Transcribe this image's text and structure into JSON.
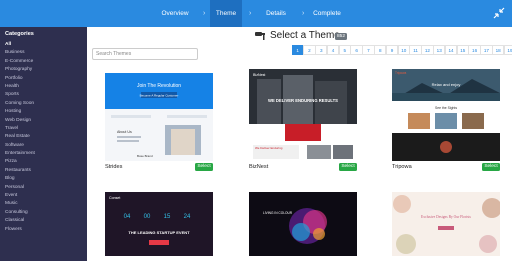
{
  "nav": {
    "steps": [
      {
        "label": "Overview"
      },
      {
        "label": "Theme"
      },
      {
        "label": "Details"
      },
      {
        "label": "Complete"
      }
    ],
    "active_step": 1,
    "separator": "›"
  },
  "sidebar": {
    "title": "Categories",
    "items": [
      {
        "label": "All"
      },
      {
        "label": "Business"
      },
      {
        "label": "E-Commerce"
      },
      {
        "label": "Photography"
      },
      {
        "label": "Portfolio"
      },
      {
        "label": "Health"
      },
      {
        "label": "Sports"
      },
      {
        "label": "Coming Soon"
      },
      {
        "label": "Hosting"
      },
      {
        "label": "Web Design"
      },
      {
        "label": "Travel"
      },
      {
        "label": "Real Estate"
      },
      {
        "label": "Software"
      },
      {
        "label": "Entertainment"
      },
      {
        "label": "Pizza"
      },
      {
        "label": "Restaurants"
      },
      {
        "label": "Blog"
      },
      {
        "label": "Personal"
      },
      {
        "label": "Event"
      },
      {
        "label": "Music"
      },
      {
        "label": "Consulting"
      },
      {
        "label": "Classical"
      },
      {
        "label": "Flowers"
      }
    ]
  },
  "header": {
    "title": "Select a Theme",
    "count": "852"
  },
  "search": {
    "placeholder": "Search Themes"
  },
  "pagination": {
    "pages": [
      "1",
      "2",
      "3",
      "4",
      "5",
      "6",
      "7",
      "8",
      "9",
      "10",
      "11",
      "12",
      "13",
      "14",
      "15",
      "16",
      "17",
      "18",
      "19"
    ],
    "active": "1"
  },
  "themes": [
    {
      "name": "Strides",
      "select_label": "Select",
      "preview": {
        "hero_title": "Join The Revolution",
        "hero_button": "Become A Regular Customer",
        "section_title": "About Us",
        "footer_text": "Bose Brand"
      }
    },
    {
      "name": "BizNest",
      "select_label": "Select",
      "preview": {
        "brand": "BizNest",
        "hero_title": "WE DELIVER ENDURING RESULTS",
        "footer_text": "We Deliver Enduring"
      }
    },
    {
      "name": "Tripowa",
      "select_label": "Select",
      "preview": {
        "brand": "Tripowa",
        "hero_title": "Relax and enjoy",
        "section_title": "See the Sights"
      }
    },
    {
      "name": "",
      "preview": {
        "brand": "Conset",
        "countdown": [
          "04",
          "00",
          "15",
          "24"
        ],
        "hero_title": "THE LEADING STARTUP EVENT"
      }
    },
    {
      "name": "",
      "preview": {
        "hero_title": "LIVING IN COLOUR"
      }
    },
    {
      "name": "",
      "preview": {
        "hero_title": "Exclusive Designs By Our Florists"
      }
    }
  ],
  "colors": {
    "topbar": "#2a8ae0",
    "topbar_active": "#1e6fc0",
    "sidebar": "#2e2f4f",
    "select_button": "#28a745",
    "count_badge": "#6c757d"
  }
}
